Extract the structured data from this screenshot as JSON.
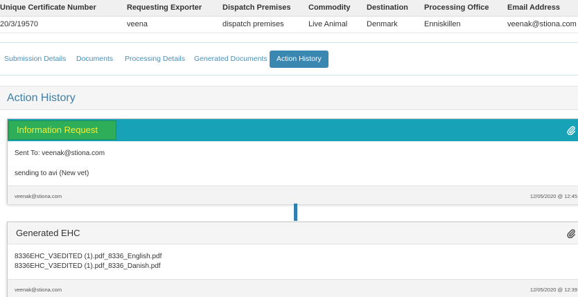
{
  "summary": {
    "headers": [
      "Unique Certificate Number",
      "Requesting Exporter",
      "Dispatch Premises",
      "Commodity",
      "Destination",
      "Processing Office",
      "Email Address"
    ],
    "row": [
      "20/3/19570",
      "veena",
      "dispatch premises",
      "Live Animal",
      "Denmark",
      "Enniskillen",
      "veenak@stiona.com"
    ]
  },
  "tabs": [
    {
      "label": "Submission Details"
    },
    {
      "label": "Documents"
    },
    {
      "label": "Processing Details"
    },
    {
      "label": "Generated Documents"
    },
    {
      "label": "Action History",
      "active": true
    }
  ],
  "action_history": {
    "title": "Action History",
    "entries": [
      {
        "type": "Information Request",
        "sent_to": "Sent To: veenak@stiona.com",
        "message": "sending to avi (New vet)",
        "user": "veenak@stiona.com",
        "timestamp": "12/05/2020 @ 12:45",
        "attachment_icon": "paperclip-icon",
        "header_color": "#17a2b8",
        "badge_color": "#2fae5a",
        "badge_text_color": "#f5ee34"
      },
      {
        "type": "Generated EHC",
        "files": [
          "8336EHC_V3EDITED (1).pdf_8336_English.pdf",
          "8336EHC_V3EDITED (1).pdf_8336_Danish.pdf"
        ],
        "user": "veenak@stiona.com",
        "timestamp": "12/05/2020 @ 12:39",
        "attachment_icon": "paperclip-icon"
      }
    ]
  },
  "colors": {
    "accent": "#3a87b2",
    "link": "#4a8fb8",
    "title": "#3f7ea6",
    "connector": "#2f7fb0"
  }
}
